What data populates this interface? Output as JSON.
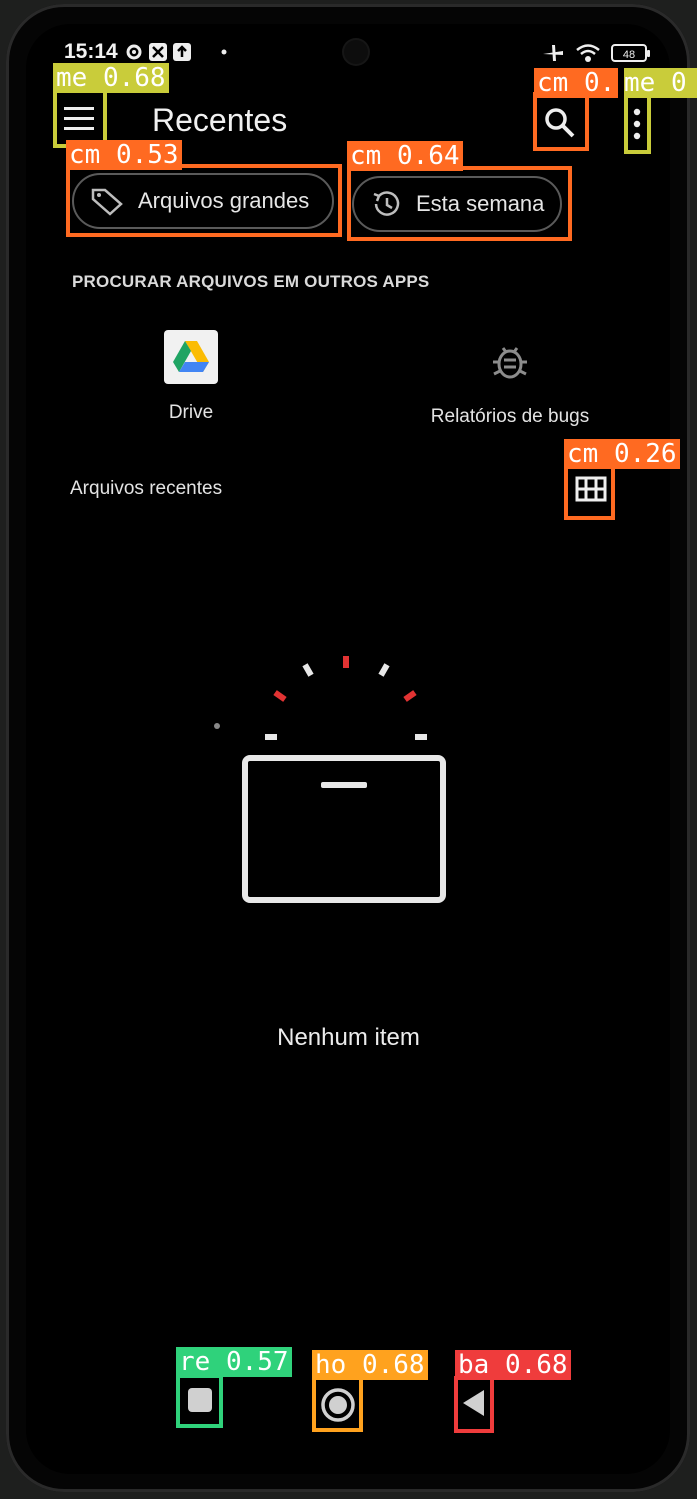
{
  "status_bar": {
    "time": "15:14",
    "battery": "48"
  },
  "app_bar": {
    "title": "Recentes"
  },
  "chips": [
    {
      "label": "Arquivos grandes"
    },
    {
      "label": "Esta semana"
    }
  ],
  "browse_section": {
    "header": "PROCURAR ARQUIVOS EM OUTROS APPS",
    "apps": [
      {
        "label": "Drive",
        "icon": "google-drive-icon"
      },
      {
        "label": "Relatórios de bugs",
        "icon": "bug-icon"
      }
    ]
  },
  "recent_files": {
    "label": "Arquivos recentes",
    "empty_message": "Nenhum item"
  },
  "detections": [
    {
      "label": "me 0.68",
      "color": "#c9cc3a"
    },
    {
      "label": "cm 0.",
      "color": "#ff6a21"
    },
    {
      "label": "me 0",
      "color": "#c9cc3a"
    },
    {
      "label": "cm 0.53",
      "color": "#ff6a21"
    },
    {
      "label": "cm 0.64",
      "color": "#ff6a21"
    },
    {
      "label": "cm 0.26",
      "color": "#ff6a21"
    },
    {
      "label": "re 0.57",
      "color": "#2fd27b"
    },
    {
      "label": "ho 0.68",
      "color": "#ffa21e"
    },
    {
      "label": "ba 0.68",
      "color": "#ef3c3c"
    }
  ]
}
